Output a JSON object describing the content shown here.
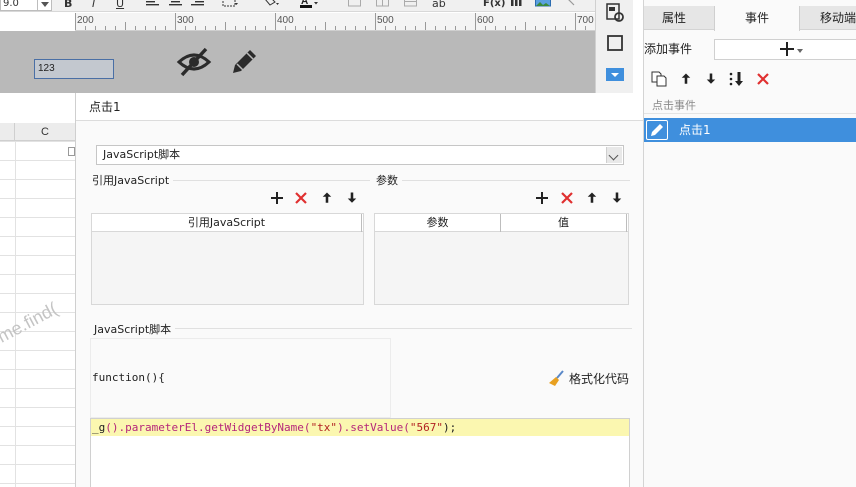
{
  "toolbar": {
    "font_size": "9.0",
    "bold": "B",
    "italic": "I",
    "underline": "U",
    "text_style": "ab",
    "formula": "F(x)"
  },
  "ruler": {
    "labels": [
      "200",
      "300",
      "400",
      "500",
      "600",
      "700"
    ]
  },
  "canvas": {
    "widget_text": "123"
  },
  "sheet": {
    "col_header": "C",
    "watermark": "me.find("
  },
  "dialog": {
    "title": "点击1",
    "script_type": "JavaScript脚本",
    "ref_section_label": "引用JavaScript",
    "ref_grid_header": "引用JavaScript",
    "param_section_label": "参数",
    "param_grid_headers": [
      "参数",
      "值"
    ],
    "script_section_label": "JavaScript脚本",
    "function_header": "function(){",
    "format_code_label": "格式化代码",
    "code": {
      "p1": "_g",
      "p2": "().parameterEl.getWidgetByName(",
      "p3": "\"tx\"",
      "p4": ").setValue(",
      "p5": "\"567\"",
      "p6": ");"
    }
  },
  "right_panel": {
    "tabs": [
      "属性",
      "事件",
      "移动端"
    ],
    "active_tab": "事件",
    "add_event_label": "添加事件",
    "event_group_label": "点击事件",
    "event_item_label": "点击1"
  },
  "colors": {
    "accent_blue": "#3f8fdd",
    "delete_red": "#e03030",
    "code_highlight": "#fbf7b0"
  }
}
